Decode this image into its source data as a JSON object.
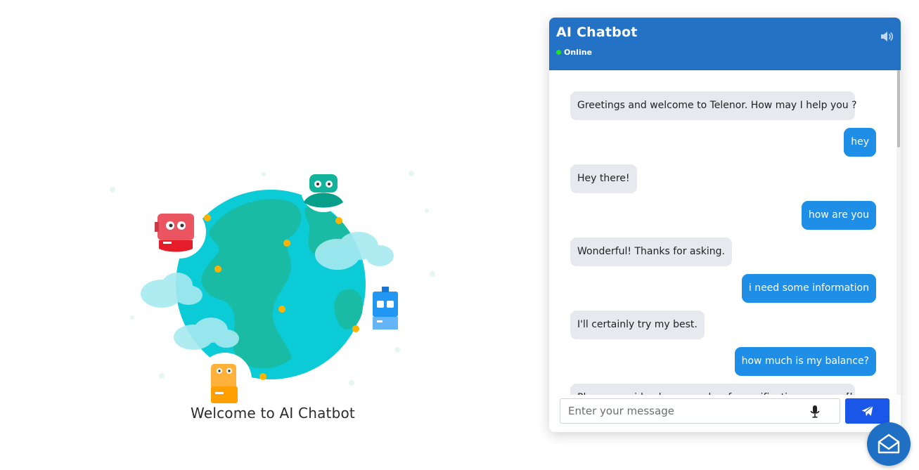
{
  "hero": {
    "caption": "Welcome to AI Chatbot"
  },
  "chat": {
    "title": "AI Chatbot",
    "status": "Online",
    "status_color": "#1ee61e",
    "header_color": "#2472c6",
    "messages": [
      {
        "sender": "bot",
        "text": "Greetings and welcome to Telenor. How may I help you ?"
      },
      {
        "sender": "user",
        "text": "hey"
      },
      {
        "sender": "bot",
        "text": "Hey there!"
      },
      {
        "sender": "user",
        "text": "how are you"
      },
      {
        "sender": "bot",
        "text": "Wonderful! Thanks for asking."
      },
      {
        "sender": "user",
        "text": "i need some information"
      },
      {
        "sender": "bot",
        "text": "I'll certainly try my best."
      },
      {
        "sender": "user",
        "text": "how much is my balance?"
      },
      {
        "sender": "bot",
        "text": "Please provide phone number for verification purpose [keep"
      }
    ],
    "input": {
      "placeholder": "Enter your message",
      "value": ""
    },
    "icons": {
      "speaker": "speaker-icon",
      "mic": "microphone-icon",
      "send": "paper-plane-icon",
      "launcher": "envelope-open-icon"
    },
    "send_button_color": "#1a56e8",
    "bot_bubble_color": "#e7e9ef",
    "user_bubble_color": "#1e8ee6"
  }
}
